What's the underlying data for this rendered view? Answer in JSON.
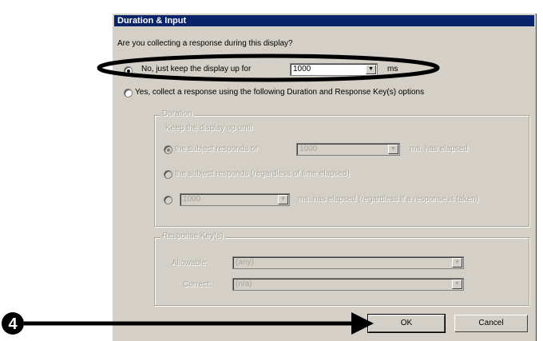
{
  "dialog": {
    "title": "Duration & Input",
    "question": "Are you collecting a response during this display?",
    "option_no": {
      "label": "No, just keep the display up for",
      "duration": "1000",
      "unit": "ms"
    },
    "option_yes": {
      "label": "Yes, collect a response using the following Duration and Response Key(s) options"
    },
    "duration_group": {
      "title": "Duration",
      "keep_label": "Keep the display up until",
      "opt1": {
        "label": "the subject responds or",
        "value": "1000",
        "suffix": "ms. has elapsed"
      },
      "opt2": {
        "label": "the subject responds (regardless of time elapsed)"
      },
      "opt3": {
        "value": "1000",
        "suffix": "ms. has elapsed (regardless if a response is taken)"
      }
    },
    "response_group": {
      "title": "Response Key(s)",
      "allowable_label": "Allowable:",
      "allowable_value": "{any}",
      "correct_label": "Correct:",
      "correct_value": "{n/a}"
    },
    "buttons": {
      "ok": "OK",
      "cancel": "Cancel"
    }
  },
  "callout": {
    "number": "4"
  }
}
